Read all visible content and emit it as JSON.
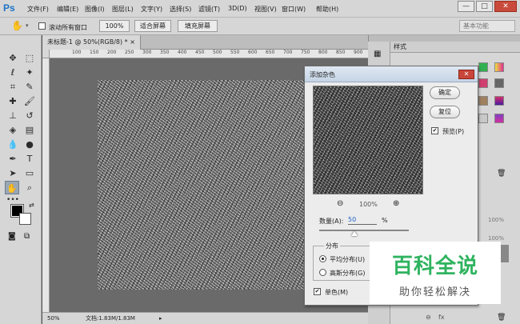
{
  "app": {
    "logo": "Ps"
  },
  "menu": [
    "文件(F)",
    "编辑(E)",
    "图像(I)",
    "图层(L)",
    "文字(Y)",
    "选择(S)",
    "滤镜(T)",
    "3D(D)",
    "视图(V)",
    "窗口(W)",
    "帮助(H)"
  ],
  "window_controls": {
    "minimize": "—",
    "restore": "□",
    "close": "✕"
  },
  "options_bar": {
    "scroll_all_windows": "滚动所有窗口",
    "zoom_100": "100%",
    "fit_screen": "适合屏幕",
    "fill_screen": "填充屏幕",
    "workspace": "基本功能"
  },
  "document": {
    "tab_title": "未标题-1 @ 50%(RGB/8) * ×",
    "ruler_ticks": [
      "100",
      "150",
      "200",
      "250",
      "300",
      "350",
      "400",
      "450",
      "500",
      "550",
      "600",
      "650",
      "700",
      "750",
      "800",
      "850",
      "900"
    ],
    "status_zoom": "50%",
    "status_doc": "文档:1.83M/1.83M"
  },
  "panels": {
    "styles_tab": "样式",
    "opacity_label": "100%",
    "fill_label": "100%"
  },
  "dialog": {
    "title": "添加杂色",
    "ok": "确定",
    "reset": "复位",
    "preview_label": "预览(P)",
    "zoom_value": "100%",
    "amount_label": "数量(A):",
    "amount_value": "50",
    "amount_unit": "%",
    "distribution_label": "分布",
    "uniform": "平均分布(U)",
    "gaussian": "高斯分布(G)",
    "monochrome": "单色(M)"
  },
  "watermark": {
    "title": "百科全说",
    "subtitle": "助你轻松解决"
  },
  "colors": {
    "accent": "#1c73c7",
    "watermark_green": "#2fb35f",
    "close_red": "#c94a3b"
  },
  "icons": {
    "toolbar": [
      "move-icon",
      "marquee-icon",
      "lasso-icon",
      "magic-wand-icon",
      "crop-icon",
      "eyedropper-icon",
      "healing-icon",
      "brush-icon",
      "stamp-icon",
      "history-brush-icon",
      "eraser-icon",
      "gradient-icon",
      "blur-icon",
      "dodge-icon",
      "pen-icon",
      "type-icon",
      "path-select-icon",
      "shape-icon",
      "hand-icon",
      "zoom-icon"
    ]
  }
}
